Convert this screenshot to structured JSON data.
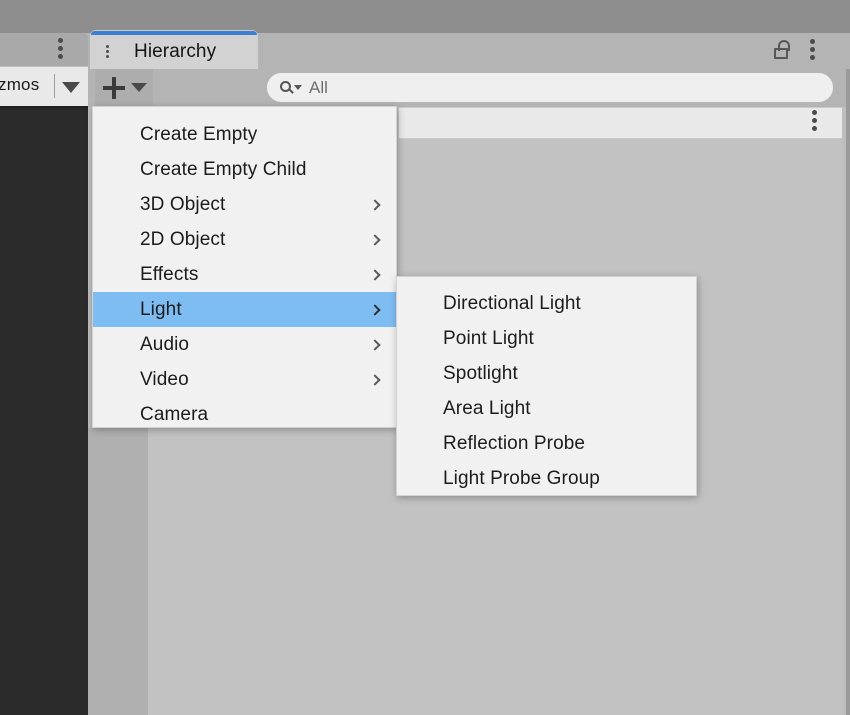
{
  "window": {
    "left_panel": {
      "tab_label_truncated": "zmos",
      "tab_full_label": "Gizmos"
    },
    "hierarchy_tab": {
      "title": "Hierarchy",
      "icon": "hierarchy-list-icon",
      "accent_color": "#3d80d1",
      "active": true
    },
    "toolbar": {
      "add_button_label": "+",
      "add_button_caret": "▼",
      "search_placeholder": "All",
      "search_value": "All",
      "search_icon": "search-dropdown-icon"
    },
    "titlebar_controls": {
      "lock_icon": "unlocked-padlock-icon",
      "menu_icon": "kebab-menu-icon"
    }
  },
  "context_menu": {
    "items": [
      {
        "label": "Create Empty",
        "submenu": false,
        "selected": false
      },
      {
        "label": "Create Empty Child",
        "submenu": false,
        "selected": false
      },
      {
        "label": "3D Object",
        "submenu": true,
        "selected": false
      },
      {
        "label": "2D Object",
        "submenu": true,
        "selected": false
      },
      {
        "label": "Effects",
        "submenu": true,
        "selected": false
      },
      {
        "label": "Light",
        "submenu": true,
        "selected": true
      },
      {
        "label": "Audio",
        "submenu": true,
        "selected": false
      },
      {
        "label": "Video",
        "submenu": true,
        "selected": false
      },
      {
        "label": "Camera",
        "submenu": false,
        "selected": false
      }
    ],
    "highlight_color": "#7dbdf2",
    "background_color": "#f1f1f1"
  },
  "submenu": {
    "parent": "Light",
    "items": [
      {
        "label": "Directional Light"
      },
      {
        "label": "Point Light"
      },
      {
        "label": "Spotlight"
      },
      {
        "label": "Area Light"
      },
      {
        "label": "Reflection Probe"
      },
      {
        "label": "Light Probe Group"
      }
    ]
  },
  "colors": {
    "chrome_top": "#8e8e8e",
    "tab_strip": "#b4b4b4",
    "panel_bg": "#bdbdbd",
    "scene_view": "#2b2b2b",
    "content_area": "#c2c2c2"
  }
}
